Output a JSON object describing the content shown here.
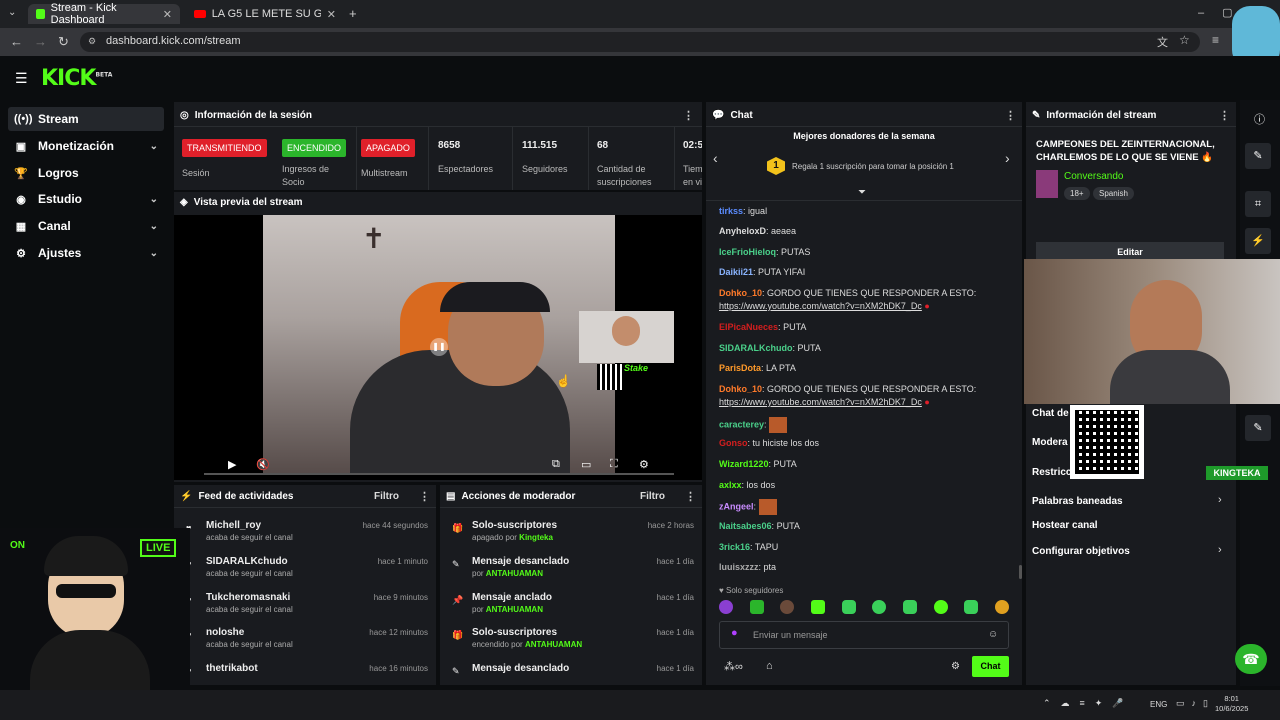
{
  "browser": {
    "tabs": [
      {
        "label": "Stream - Kick Dashboard"
      },
      {
        "label": "LA G5 LE METE SU GOLPE A KI"
      }
    ],
    "url": "dashboard.kick.com/stream"
  },
  "logo": {
    "text": "KICK",
    "sup": "BETA"
  },
  "sidebar": {
    "items": [
      {
        "label": "Stream"
      },
      {
        "label": "Monetización"
      },
      {
        "label": "Logros"
      },
      {
        "label": "Estudio"
      },
      {
        "label": "Canal"
      },
      {
        "label": "Ajustes"
      }
    ]
  },
  "session": {
    "title": "Información de la sesión",
    "badges": [
      {
        "text": "TRANSMITIENDO",
        "label": "Sesión",
        "color": "#e0202a"
      },
      {
        "text": "ENCENDIDO",
        "label": "Ingresos de Socio",
        "color": "#2bb52b"
      },
      {
        "text": "APAGADO",
        "label": "Multistream",
        "color": "#e0202a"
      }
    ],
    "stats": [
      {
        "value": "8658",
        "label": "Espectadores"
      },
      {
        "value": "111.515",
        "label": "Seguidores"
      },
      {
        "value": "68",
        "label": "Cantidad de suscripciones"
      },
      {
        "value": "02:5",
        "label": "Tiem en vi"
      }
    ]
  },
  "preview": {
    "title": "Vista previa del stream"
  },
  "feed": {
    "title": "Feed de actividades",
    "filter": "Filtro",
    "items": [
      {
        "name": "Michell_roy",
        "sub": "acaba de seguir el canal",
        "time": "hace 44 segundos"
      },
      {
        "name": "SIDARALKchudo",
        "sub": "acaba de seguir el canal",
        "time": "hace 1 minuto"
      },
      {
        "name": "Tukcheromasnaki",
        "sub": "acaba de seguir el canal",
        "time": "hace 9 minutos"
      },
      {
        "name": "noloshe",
        "sub": "acaba de seguir el canal",
        "time": "hace 12 minutos"
      },
      {
        "name": "thetrikabot",
        "sub": "",
        "time": "hace 16 minutos"
      }
    ]
  },
  "mod": {
    "title": "Acciones de moderador",
    "filter": "Filtro",
    "items": [
      {
        "name": "Solo-suscriptores",
        "pre": "apagado por",
        "who": "Kingteka",
        "time": "hace 2 horas"
      },
      {
        "name": "Mensaje desanclado",
        "pre": "por",
        "who": "ANTAHUAMAN",
        "time": "hace 1 día"
      },
      {
        "name": "Mensaje anclado",
        "pre": "por",
        "who": "ANTAHUAMAN",
        "time": "hace 1 día"
      },
      {
        "name": "Solo-suscriptores",
        "pre": "encendido por",
        "who": "ANTAHUAMAN",
        "time": "hace 1 día"
      },
      {
        "name": "Mensaje desanclado",
        "pre": "",
        "who": "",
        "time": "hace 1 día"
      }
    ]
  },
  "chat": {
    "title": "Chat",
    "top_title": "Mejores donadores de la semana",
    "top_rank": "1",
    "top_text": "Regala 1 suscripción para tomar la posición 1",
    "messages": [
      {
        "user": "tirkss",
        "color": "#5b8cff",
        "text": "igual"
      },
      {
        "user": "AnyheloxD",
        "color": "#dddddd",
        "text": "aeaea"
      },
      {
        "user": "IceFrioHieloq",
        "color": "#4ad08a",
        "text": "PUTAS"
      },
      {
        "user": "Daikii21",
        "color": "#8ab4ff",
        "text": "PUTA YIFAI"
      },
      {
        "user": "Dohko_10",
        "color": "#ff7a2a",
        "text": "GORDO QUE TIENES QUE RESPONDER A ESTO:",
        "link": "https://www.youtube.com/watch?v=nXM2hDK7_Dc"
      },
      {
        "user": "ElPicaNueces",
        "color": "#d41e1e",
        "text": "PUTA"
      },
      {
        "user": "SIDARALKchudo",
        "color": "#4ad08a",
        "text": "PUTA"
      },
      {
        "user": "ParisDota",
        "color": "#ff9a2a",
        "text": "LA PTA"
      },
      {
        "user": "Dohko_10",
        "color": "#ff7a2a",
        "text": "GORDO QUE TIENES QUE RESPONDER A ESTO:",
        "link": "https://www.youtube.com/watch?v=nXM2hDK7_Dc"
      },
      {
        "user": "caracterey",
        "color": "#4ad08a",
        "text": ""
      },
      {
        "user": "Gonso",
        "color": "#d41e1e",
        "text": "tu hiciste los dos"
      },
      {
        "user": "Wizard1220",
        "color": "#53fc18",
        "text": "PUTA"
      },
      {
        "user": "axlxx",
        "color": "#53fc18",
        "text": "los dos"
      },
      {
        "user": "zAngeel",
        "color": "#c98cff",
        "text": ""
      },
      {
        "user": "Naitsabes06",
        "color": "#4ad08a",
        "text": "PUTA"
      },
      {
        "user": "3rick16",
        "color": "#4ad08a",
        "text": "TAPU"
      },
      {
        "user": "luuisxzzz",
        "color": "#aaaaaa",
        "text": "pta"
      }
    ],
    "followers_only": "Solo seguidores",
    "placeholder": "Enviar un mensaje",
    "send": "Chat"
  },
  "info": {
    "title": "Información del stream",
    "stream_title": "CAMPEONES DEL ZEINTERNACIONAL, CHARLEMOS DE LO QUE SE VIENE 🔥",
    "category": "Conversando",
    "tag_age": "18+",
    "tag_lang": "Spanish",
    "edit": "Editar",
    "items": [
      {
        "label": "Chat de"
      },
      {
        "label": "Modera"
      },
      {
        "label": "Restricc"
      },
      {
        "label": "Palabras baneadas"
      },
      {
        "label": "Hostear canal"
      },
      {
        "label": "Configurar objetivos"
      }
    ]
  },
  "overlay": {
    "on": "ON",
    "live": "LIVE",
    "brand": "KINGTEKA",
    "stake": "Stake"
  },
  "taskbar": {
    "lang": "ENG",
    "time": "8:01",
    "date": "10/6/2025"
  }
}
